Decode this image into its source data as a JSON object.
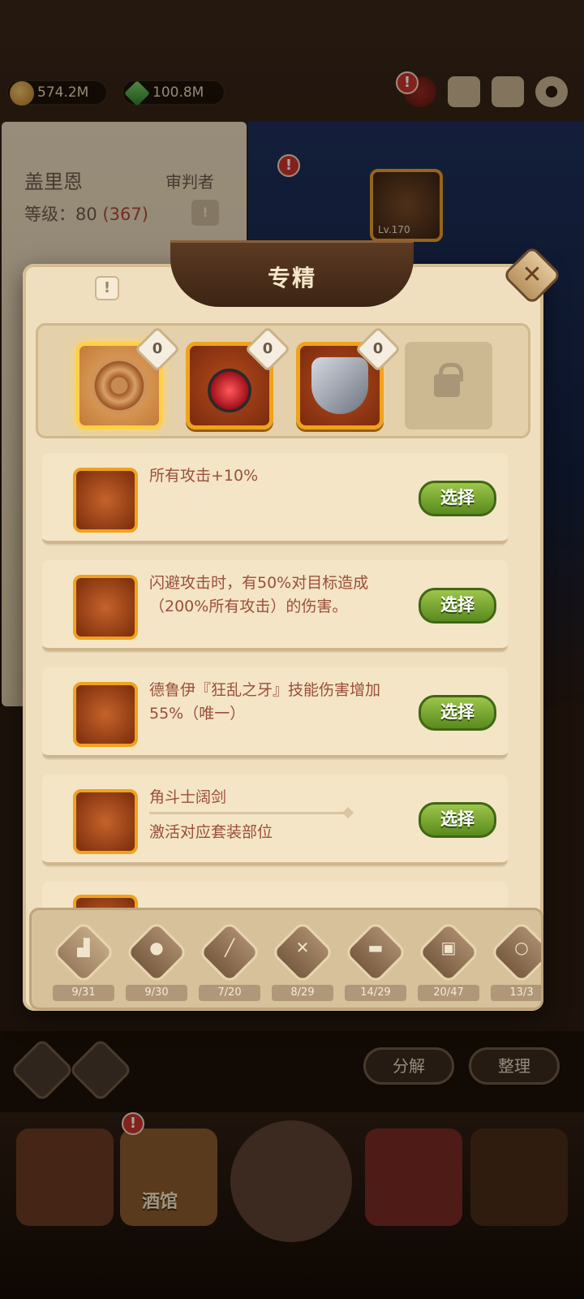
{
  "topbar": {
    "gold": "574.2M",
    "gems": "100.8M",
    "icons": [
      "bag-icon",
      "chat-icon",
      "mail-icon",
      "gear-icon"
    ]
  },
  "hero": {
    "name": "盖里恩",
    "class": "审判者",
    "level_label": "等级：",
    "level": "80",
    "level_extra": "(367)",
    "equip_level": "Lv.170"
  },
  "modal": {
    "title": "专精",
    "close_glyph": "✕",
    "info_glyph": "!",
    "slots": [
      {
        "icon": "amulet-icon",
        "selected": true
      },
      {
        "icon": "ruby-pendant-icon",
        "selected": false
      },
      {
        "icon": "gauntlet-icon",
        "selected": false
      },
      {
        "icon": "lock-icon",
        "locked": true
      }
    ],
    "options": [
      {
        "icon": "sword-icon",
        "text": "所有攻击+10%",
        "button": "选择"
      },
      {
        "icon": "dagger-icon",
        "text": "闪避攻击时，有50%对目标造成（200%所有攻击）的伤害。",
        "button": "选择"
      },
      {
        "icon": "curved-blade-icon",
        "text": "德鲁伊『狂乱之牙』技能伤害增加55%（唯一）",
        "button": "选择"
      },
      {
        "icon": "gladiator-sword-icon",
        "text": "角斗士阔剑",
        "sub": "激活对应套装部位",
        "button": "选择"
      }
    ],
    "tabs": [
      {
        "icon": "boot-icon",
        "count": "9/31"
      },
      {
        "icon": "drumstick-icon",
        "count": "9/30"
      },
      {
        "icon": "sword-tab-icon",
        "count": "7/20"
      },
      {
        "icon": "shield-tab-icon",
        "count": "8/29"
      },
      {
        "icon": "book-icon",
        "count": "14/29"
      },
      {
        "icon": "helmet-icon",
        "count": "20/47"
      },
      {
        "icon": "staff-icon",
        "count": "13/3"
      }
    ]
  },
  "actions": {
    "decompose": "分解",
    "organize": "整理"
  },
  "bottom_nav": {
    "tavern": "酒馆"
  },
  "colors": {
    "accent_orange": "#f0a21d",
    "select_green": "#6fa22c",
    "text_brown": "#9a4f3a"
  }
}
